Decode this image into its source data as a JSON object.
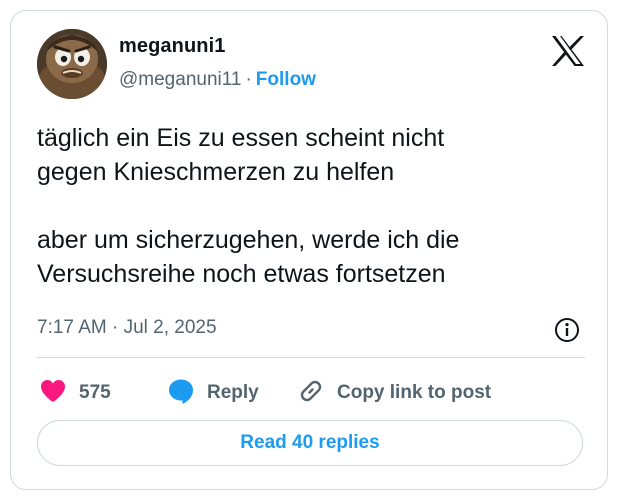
{
  "author": {
    "display_name": "meganuni1",
    "handle": "@meganuni11",
    "separator": "·",
    "follow_label": "Follow"
  },
  "tweet": {
    "text": "täglich ein Eis zu essen scheint nicht\ngegen Knieschmerzen zu helfen\n\naber um sicherzugehen, werde ich die\nVersuchsreihe noch etwas fortsetzen",
    "timestamp": "7:17 AM · Jul 2, 2025"
  },
  "actions": {
    "like_count": "575",
    "reply_label": "Reply",
    "copy_label": "Copy link to post"
  },
  "read_replies_label": "Read 40 replies",
  "icons": {
    "logo": "x-logo-icon",
    "info": "info-icon",
    "like": "heart-icon",
    "reply": "speech-bubble-icon",
    "copy": "link-icon"
  },
  "colors": {
    "accent": "#1d9bf0",
    "like": "#f91880",
    "muted": "#536471",
    "text": "#0f1419",
    "border": "#cfd9de"
  }
}
